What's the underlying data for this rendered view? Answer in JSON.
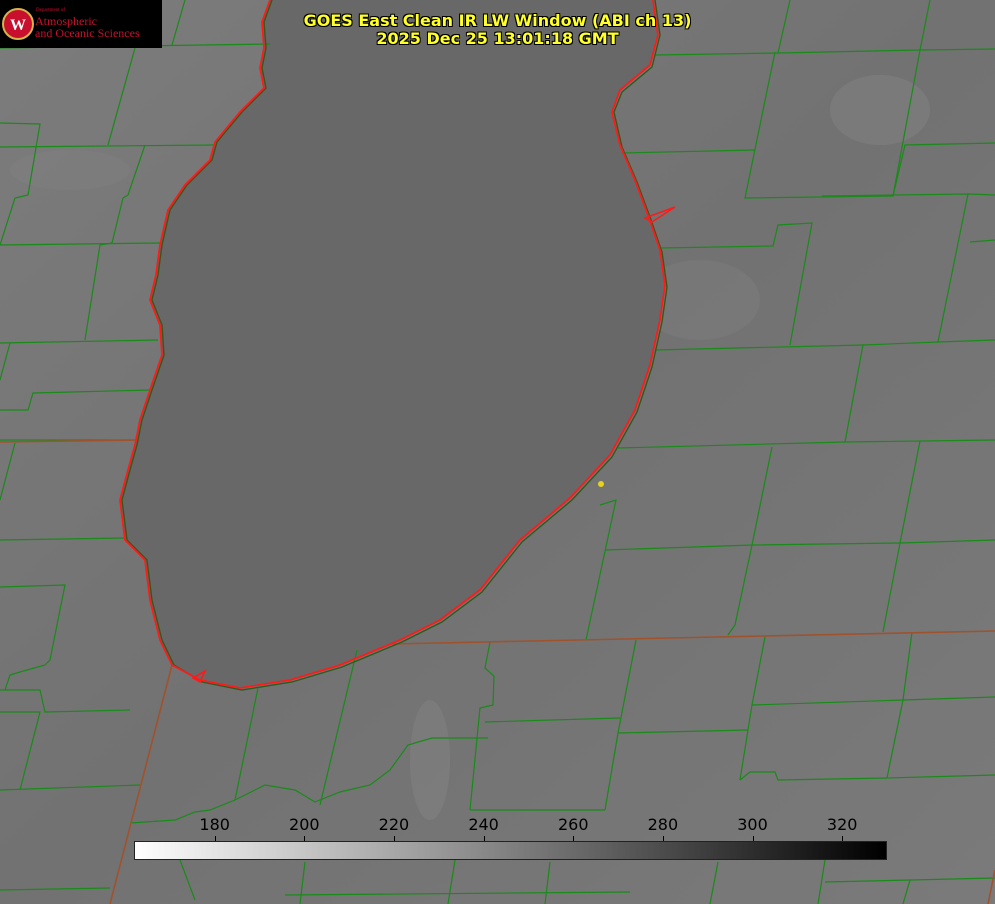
{
  "header": {
    "title_line1": "GOES East Clean IR LW Window (ABI ch 13)",
    "title_line2": "2025 Dec 25 13:01:18 GMT"
  },
  "logo": {
    "icon": "uw-crest-icon",
    "department": "Department of",
    "line1": "Atmospheric",
    "line2": "and Oceanic Sciences",
    "color": "#c8102e"
  },
  "colorbar": {
    "min": 162,
    "max": 330,
    "ticks": [
      {
        "value": 180,
        "label": "180"
      },
      {
        "value": 200,
        "label": "200"
      },
      {
        "value": 220,
        "label": "220"
      },
      {
        "value": 240,
        "label": "240"
      },
      {
        "value": 260,
        "label": "260"
      },
      {
        "value": 280,
        "label": "280"
      },
      {
        "value": 300,
        "label": "300"
      },
      {
        "value": 320,
        "label": "320"
      }
    ]
  },
  "colors": {
    "title": "#ffff2a",
    "county_lines": "#1a8a1a",
    "state_lines": "#a0522d",
    "lake_outline": "#ff1a1a",
    "station_marker": "#e6d21e"
  }
}
